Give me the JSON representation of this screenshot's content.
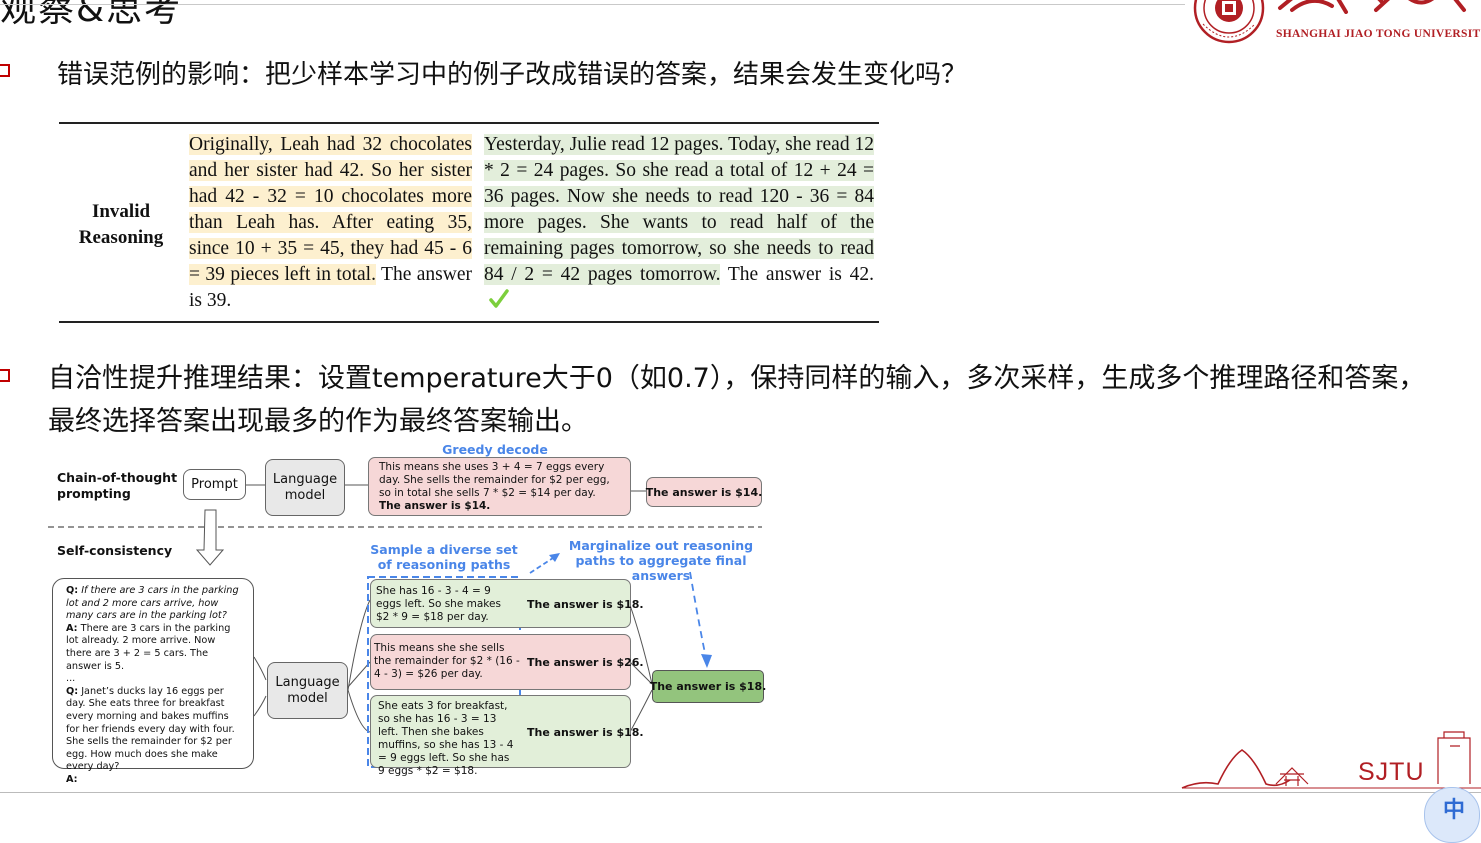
{
  "header": {
    "title": "观察&思考",
    "logo": {
      "cn_name": "上海交通大学",
      "en_name": "SHANGHAI JIAO TONG UNIVERSITY"
    }
  },
  "bullet1": {
    "text": "错误范例的影响：把少样本学习中的例子改成错误的答案，结果会发生变化吗？"
  },
  "table": {
    "row_label": "Invalid Reasoning",
    "left_cell": "Originally, Leah had 32 chocolates and her sister had 42. So her sister had 42 - 32 = 10 chocolates more than Leah has. After eating 35, since 10 + 35 = 45, they had 45 - 6 = 39 pieces left in total. The answer is 39.",
    "left_highlight": "Originally, Leah had 32 chocolates and her sister had 42. So her sister had 42 - 32 = 10 chocolates more than Leah has. After eating 35, since 10 + 35 = 45, they had 45 - 6 = 39 pieces left in total.",
    "left_answer": "The answer is 39.",
    "right_cell": "Yesterday, Julie read 12 pages. Today, she read 12 * 2 = 24 pages. So she read a total of 12 + 24 = 36 pages. Now she needs to read 120 - 36 = 84 more pages. She wants to read half of the remaining pages tomorrow, so she needs to read 84 / 2 = 42 pages tomorrow. The answer is 42.",
    "right_highlight": "Yesterday, Julie read 12 pages. Today, she read 12 * 2 = 24 pages. So she read a total of 12 + 24 = 36 pages. Now she needs to read 120 - 36 = 84 more pages. She wants to read half of the remaining pages tomorrow, so she needs to read 84 / 2 = 42 pages tomorrow.",
    "right_answer": "The answer is 42.",
    "check_icon": "check-icon"
  },
  "bullet2": {
    "text": "自洽性提升推理结果：设置temperature大于0（如0.7），保持同样的输入，多次采样，生成多个推理路径和答案，最终选择答案出现最多的作为最终答案输出。"
  },
  "diagram": {
    "cot_label": "Chain-of-thought prompting",
    "prompt_label": "Prompt",
    "lm_label": "Language model",
    "greedy_label": "Greedy decode",
    "greedy_text": "This means she uses 3 + 4 = 7 eggs every day. She sells the remainder for $2 per egg, so in total she sells 7 * $2 = $14 per day.",
    "greedy_bold": "The answer is $14.",
    "greedy_answer": "The answer is $14.",
    "sc_label": "Self-consistency",
    "sample_label": "Sample a diverse set of reasoning paths",
    "marginalize_label": "Marginalize out reasoning paths to aggregate final answers",
    "q_box": {
      "q1_prefix": "Q:",
      "q1": "If there are 3 cars in the parking lot and 2 more cars arrive, how many cars are in the parking lot?",
      "a1_prefix": "A:",
      "a1": "There are 3 cars in the parking lot already. 2 more arrive. Now there are 3 + 2 = 5 cars. The answer is 5.",
      "ellipsis": "...",
      "q2_prefix": "Q:",
      "q2": "Janet’s ducks lay 16 eggs per day. She eats three for breakfast every morning and bakes muffins for her friends every day with four. She sells the remainder for $2 per egg. How much does she make every day?",
      "a2_prefix": "A:"
    },
    "paths": [
      {
        "text": "She has 16 - 3 - 4 = 9 eggs left. So she makes $2 * 9 = $18 per day.",
        "answer": "The answer is $18.",
        "color": "#e2efd9"
      },
      {
        "text": "This means she she sells the remainder for $2 * (16 - 4 - 3) = $26 per day.",
        "answer": "The answer is $26.",
        "color": "#f6d7d7"
      },
      {
        "text": "She eats 3 for breakfast, so she has 16 - 3 = 13 left. Then she bakes muffins, so she has 13 - 4 = 9 eggs left. So she has 9 eggs * $2 = $18.",
        "answer": "The answer is $18.",
        "color": "#e2efd9"
      }
    ],
    "final_answer": "The answer is $18."
  },
  "footer": {
    "sjtu_text": "SJTU",
    "corner_icon": "ime-zh-icon",
    "corner_text": "中"
  },
  "colors": {
    "bullet": "#c00000",
    "logo_red": "#b11f24",
    "highlight_yellow": "#fdf0cf",
    "highlight_green": "#e3eedb",
    "pink": "#f6d7d7",
    "light_green": "#e2efd9",
    "dark_green": "#93c47d",
    "blue": "#4a86e8",
    "check": "#7ccf3c"
  }
}
